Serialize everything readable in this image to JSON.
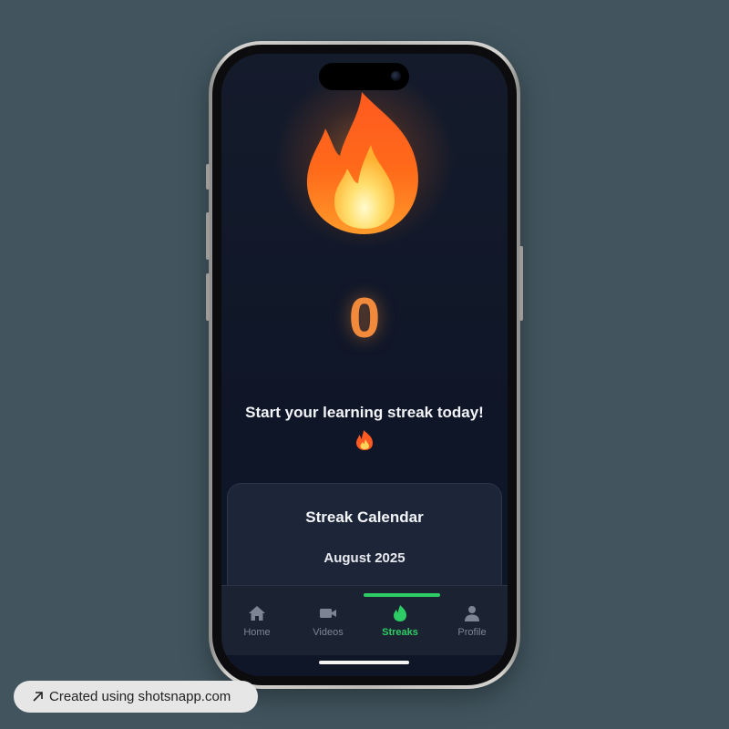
{
  "streak": {
    "count": "0",
    "message": "Start your learning streak today!",
    "message_emoji": "fire-emoji",
    "hero_icon": "fire-emoji"
  },
  "calendar": {
    "title": "Streak Calendar",
    "month": "August 2025"
  },
  "nav": {
    "items": [
      {
        "label": "Home",
        "icon": "home-icon",
        "active": false
      },
      {
        "label": "Videos",
        "icon": "video-camera-icon",
        "active": false
      },
      {
        "label": "Streaks",
        "icon": "flame-icon",
        "active": true
      },
      {
        "label": "Profile",
        "icon": "person-icon",
        "active": false
      }
    ]
  },
  "watermark": {
    "text": "Created using shotsnapp.com",
    "icon": "arrow-up-left-icon"
  },
  "colors": {
    "background": "#42555f",
    "screen_bg": "#0f1627",
    "card_bg": "#1d2638",
    "accent_green": "#2ecc64",
    "streak_orange": "#f28a3c",
    "nav_inactive": "#7d8595"
  }
}
